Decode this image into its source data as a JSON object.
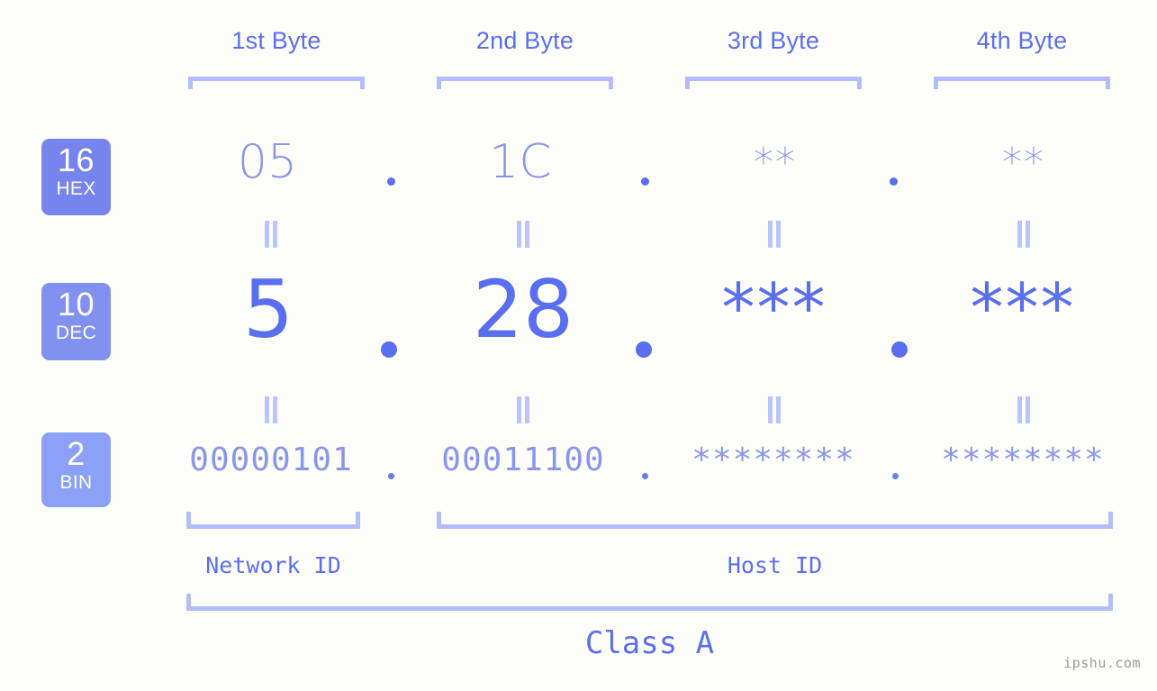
{
  "meta": {
    "background_color": "#fdfefa",
    "accent_color": "#5a6ef0",
    "light_accent_color": "#b3bdfb",
    "badge_colors": [
      "#7684ee",
      "#8191f0",
      "#8ba0f7"
    ],
    "watermark": "ipshu.com"
  },
  "byte_headers": [
    {
      "label": "1st Byte"
    },
    {
      "label": "2nd Byte"
    },
    {
      "label": "3rd Byte"
    },
    {
      "label": "4th Byte"
    }
  ],
  "bases": [
    {
      "radix": "16",
      "name": "HEX"
    },
    {
      "radix": "10",
      "name": "DEC"
    },
    {
      "radix": "2",
      "name": "BIN"
    }
  ],
  "rows": {
    "hex": {
      "radix": "16",
      "name": "HEX",
      "values": [
        "05",
        "1C",
        "**",
        "**"
      ]
    },
    "dec": {
      "radix": "10",
      "name": "DEC",
      "values": [
        "5",
        "28",
        "***",
        "***"
      ]
    },
    "bin": {
      "radix": "2",
      "name": "BIN",
      "values": [
        "00000101",
        "00011100",
        "********",
        "********"
      ]
    }
  },
  "separators": {
    "dot": ".",
    "equals": "="
  },
  "sections": [
    {
      "label": "Network ID"
    },
    {
      "label": "Host ID"
    }
  ],
  "class": {
    "label": "Class A"
  }
}
